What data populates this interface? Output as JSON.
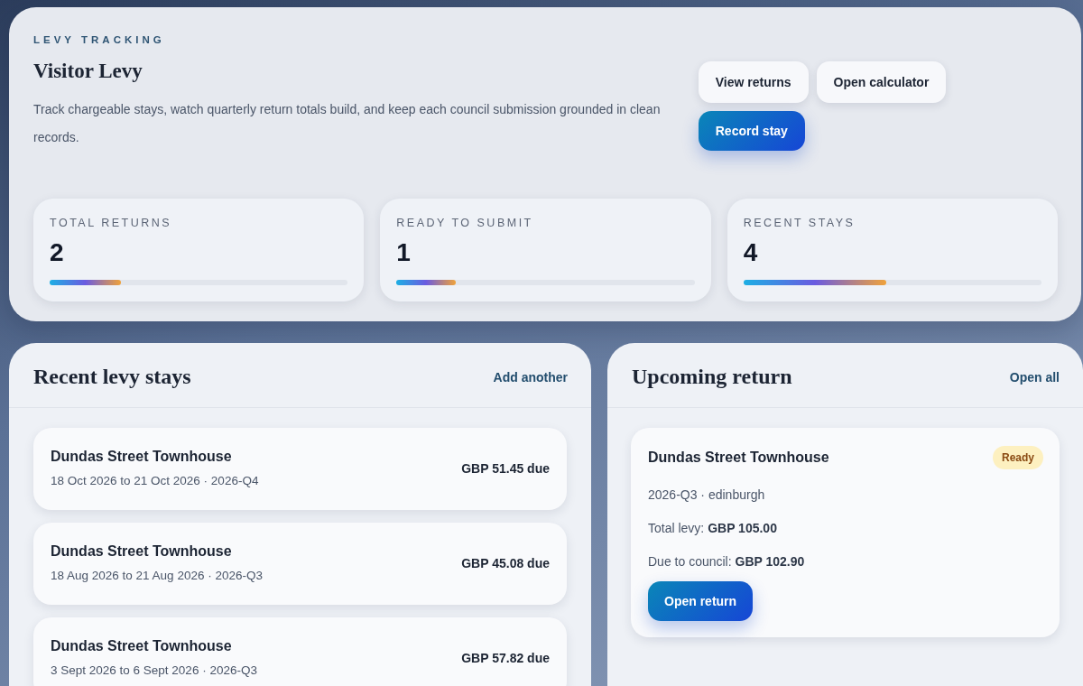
{
  "hero": {
    "eyebrow": "LEVY TRACKING",
    "title": "Visitor Levy",
    "description": "Track chargeable stays, watch quarterly return totals build, and keep each council submission grounded in clean records.",
    "actions": [
      {
        "label": "View returns",
        "kind": "secondary"
      },
      {
        "label": "Open calculator",
        "kind": "secondary"
      },
      {
        "label": "Record stay",
        "kind": "primary"
      }
    ]
  },
  "stats": [
    {
      "label": "TOTAL RETURNS",
      "value": "2",
      "level": 0.24
    },
    {
      "label": "READY TO SUBMIT",
      "value": "1",
      "level": 0.2
    },
    {
      "label": "RECENT STAYS",
      "value": "4",
      "level": 0.48
    }
  ],
  "stays_panel": {
    "title": "Recent levy stays",
    "link": "Add another",
    "items": [
      {
        "name": "Dundas Street Townhouse",
        "dates": "18 Oct 2026 to 21 Oct 2026 · 2026-Q4",
        "amount": "GBP 51.45 due"
      },
      {
        "name": "Dundas Street Townhouse",
        "dates": "18 Aug 2026 to 21 Aug 2026 · 2026-Q3",
        "amount": "GBP 45.08 due"
      },
      {
        "name": "Dundas Street Townhouse",
        "dates": "3 Sept 2026 to 6 Sept 2026 · 2026-Q3",
        "amount": "GBP 57.82 due"
      }
    ]
  },
  "return_panel": {
    "title": "Upcoming return",
    "link": "Open all",
    "return": {
      "name": "Dundas Street Townhouse",
      "status": "Ready",
      "meta": "2026-Q3 · edinburgh",
      "lines": [
        "Total levy: **GBP 105.00**",
        "Due to council: **GBP 102.90**"
      ],
      "button": "Open return"
    }
  }
}
